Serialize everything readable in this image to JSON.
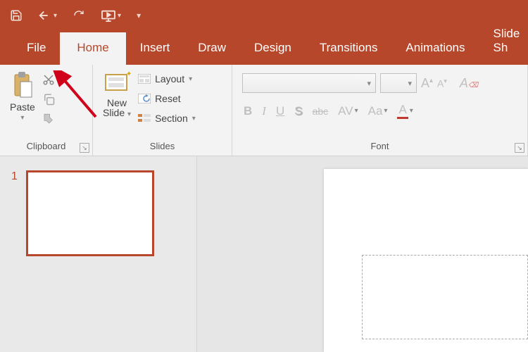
{
  "qat": {
    "save": "save-icon",
    "undo": "undo-icon",
    "redo": "redo-icon",
    "present": "present-from-start-icon",
    "customize": "customize-qat-icon"
  },
  "tabs": {
    "file": "File",
    "home": "Home",
    "insert": "Insert",
    "draw": "Draw",
    "design": "Design",
    "transitions": "Transitions",
    "animations": "Animations",
    "slideshow": "Slide Sh"
  },
  "ribbon": {
    "clipboard": {
      "paste": "Paste",
      "group_label": "Clipboard"
    },
    "slides": {
      "new_slide": "New\nSlide",
      "new_slide_l1": "New",
      "new_slide_l2": "Slide",
      "layout": "Layout",
      "reset": "Reset",
      "section": "Section",
      "group_label": "Slides"
    },
    "font": {
      "group_label": "Font",
      "bold": "B",
      "italic": "I",
      "underline": "U",
      "shadow": "S",
      "strike": "abc",
      "spacing": "AV",
      "case": "Aa",
      "color": "A",
      "grow": "A",
      "shrink": "A",
      "clear": "A"
    }
  },
  "thumbnails": {
    "slide1_number": "1"
  },
  "colors": {
    "brand": "#b7472a"
  }
}
